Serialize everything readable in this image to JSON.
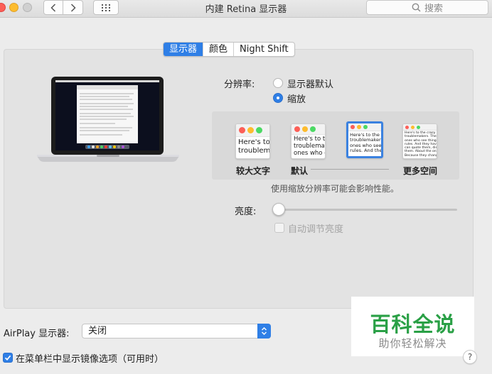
{
  "window": {
    "title": "内建 Retina 显示器"
  },
  "search": {
    "placeholder": "搜索"
  },
  "tabs": [
    {
      "label": "显示器",
      "active": true
    },
    {
      "label": "颜色",
      "active": false
    },
    {
      "label": "Night Shift",
      "active": false
    }
  ],
  "resolution": {
    "label": "分辨率:",
    "options": [
      {
        "label": "显示器默认",
        "selected": false
      },
      {
        "label": "缩放",
        "selected": true
      }
    ]
  },
  "scaling": {
    "options": [
      {
        "label": "较大文字",
        "preview_text": [
          "Here's to",
          "troublem"
        ],
        "selected": false
      },
      {
        "label": "默认",
        "preview_text": [
          "Here's to th",
          "troublemak",
          "ones who c"
        ],
        "selected": false
      },
      {
        "label": "",
        "preview_text": [
          "Here's to the cr",
          "troublemakers.",
          "ones who see t",
          "rules. And they"
        ],
        "selected": true
      },
      {
        "label": "更多空间",
        "preview_text": [
          "Here's to the crazy one",
          "troublemakers. The rou",
          "ones who see things dif",
          "rules. And they have no",
          "can quote them, disagre",
          "them. About the only th",
          "Because they change th"
        ],
        "selected": false
      }
    ],
    "hint": "使用缩放分辨率可能会影响性能。"
  },
  "brightness": {
    "label": "亮度:",
    "level": 0,
    "auto_label": "自动调节亮度",
    "auto_checked": false
  },
  "airplay": {
    "label": "AirPlay 显示器:",
    "value": "关闭"
  },
  "mirror": {
    "label": "在菜单栏中显示镜像选项（可用时）",
    "checked": true
  },
  "watermark": {
    "title": "百科全说",
    "subtitle": "助你轻松解决"
  },
  "help": {
    "label": "?"
  },
  "colors": {
    "accent": "#2f7fe6",
    "traffic_red": "#fc5f57",
    "traffic_yellow": "#fdbc2e",
    "watermark_green": "#2aa046"
  },
  "icons": [
    "chevron-left-icon",
    "chevron-right-icon",
    "grid-icon",
    "search-icon",
    "laptop-icon",
    "updown-arrows-icon",
    "checkmark-icon"
  ]
}
